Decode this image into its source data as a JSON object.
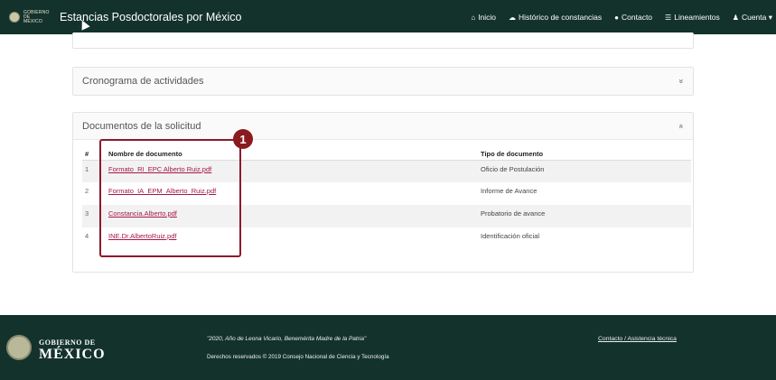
{
  "header": {
    "brand_mini": "GOBIERNO DE MÉXICO",
    "title": "Estancias Posdoctorales por México",
    "nav": [
      {
        "icon": "home-icon",
        "glyph": "⌂",
        "label": "Inicio"
      },
      {
        "icon": "history-icon",
        "glyph": "☁",
        "label": "Histórico de constancias"
      },
      {
        "icon": "chat-icon",
        "glyph": "●",
        "label": "Contacto"
      },
      {
        "icon": "list-icon",
        "glyph": "☰",
        "label": "Lineamientos"
      },
      {
        "icon": "user-icon",
        "glyph": "♟",
        "label": "Cuenta ▾"
      }
    ]
  },
  "panels": {
    "cronograma": {
      "title": "Cronograma de actividades",
      "chevron": "»"
    },
    "documentos": {
      "title": "Documentos de la solicitud",
      "chevron": "«"
    }
  },
  "table": {
    "headers": [
      "#",
      "Nombre de documento",
      "Tipo de documento"
    ],
    "rows": [
      {
        "num": "1",
        "name": "Formato_RI_EPC Alberto Ruiz.pdf",
        "type": "Oficio de Postulación"
      },
      {
        "num": "2",
        "name": "Formato_IA_EPM_Alberto_Ruiz.pdf",
        "type": "Informe de Avance"
      },
      {
        "num": "3",
        "name": "Constancia.Alberto.pdf",
        "type": "Probatorio de avance"
      },
      {
        "num": "4",
        "name": "INE.Dr.AlbertoRuiz.pdf",
        "type": "Identificación oficial"
      }
    ]
  },
  "annotation": {
    "badge": "1"
  },
  "footer": {
    "gob_small": "GOBIERNO DE",
    "gob_big": "MÉXICO",
    "quote": "\"2020, Año de Leona Vicario, Benemérita Madre de la Patria\"",
    "rights": "Derechos reservados © 2019 Consejo Nacional de Ciencia y Tecnología",
    "contact": "Contacto / Asistencia técnica"
  },
  "colors": {
    "header_bg": "#13322b",
    "link": "#a5174a",
    "callout": "#8b1a2a"
  }
}
